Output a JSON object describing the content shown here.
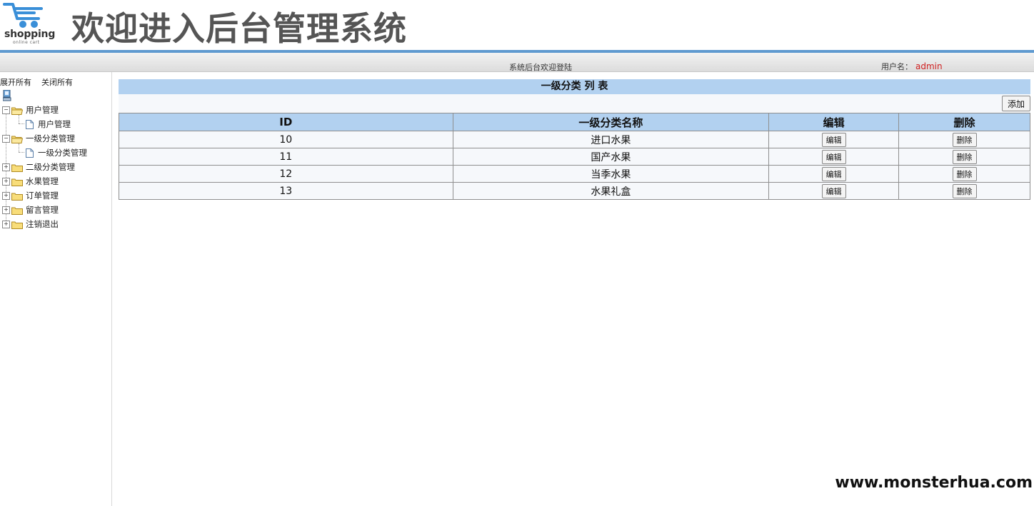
{
  "header": {
    "logo_text": "shopping",
    "logo_subtext": "online cart",
    "title": "欢迎进入后台管理系统"
  },
  "status_bar": {
    "welcome": "系统后台欢迎登陆",
    "user_label": "用户名：",
    "username": "admin"
  },
  "sidebar": {
    "expand_all": "展开所有",
    "collapse_all": "关闭所有",
    "groups": [
      {
        "label": "用户管理",
        "expanded": true,
        "children": [
          "用户管理"
        ]
      },
      {
        "label": "一级分类管理",
        "expanded": true,
        "children": [
          "一级分类管理"
        ]
      },
      {
        "label": "二级分类管理",
        "expanded": false
      },
      {
        "label": "水果管理",
        "expanded": false
      },
      {
        "label": "订单管理",
        "expanded": false
      },
      {
        "label": "留言管理",
        "expanded": false
      },
      {
        "label": "注销退出",
        "expanded": false
      }
    ]
  },
  "main": {
    "list_title": "一级分类 列 表",
    "add_label": "添加",
    "columns": [
      "ID",
      "一级分类名称",
      "编辑",
      "删除"
    ],
    "rows": [
      {
        "id": "10",
        "name": "进口水果",
        "edit": "编辑",
        "delete": "删除"
      },
      {
        "id": "11",
        "name": "国产水果",
        "edit": "编辑",
        "delete": "删除"
      },
      {
        "id": "12",
        "name": "当季水果",
        "edit": "编辑",
        "delete": "删除"
      },
      {
        "id": "13",
        "name": "水果礼盒",
        "edit": "编辑",
        "delete": "删除"
      }
    ]
  },
  "watermark": "www.monsterhua.com",
  "colors": {
    "header_line": "#5f9ad0",
    "table_header": "#b2d1f0",
    "username": "#d02020",
    "logo_cart": "#3a8fd8"
  }
}
